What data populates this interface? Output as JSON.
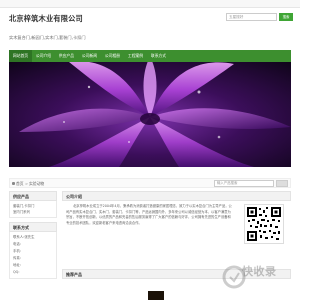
{
  "header": {
    "company_name": "北京梓筑木业有限公司",
    "tagline": "实木复合门,新园门,实木门,套装门,卡扣门",
    "search_placeholder": "五星搜好",
    "search_button": "搜索"
  },
  "nav": {
    "items": [
      {
        "label": "网站首页",
        "active": true
      },
      {
        "label": "公司介绍",
        "active": false
      },
      {
        "label": "供应产品",
        "active": false
      },
      {
        "label": "公司新闻",
        "active": false
      },
      {
        "label": "公司相册",
        "active": false
      },
      {
        "label": "工程案例",
        "active": false
      },
      {
        "label": "联系方式",
        "active": false
      }
    ]
  },
  "breadcrumb": {
    "home": "首页",
    "separator": ">",
    "current": "实验动物"
  },
  "keyword_search": {
    "placeholder": "输入产品搜索"
  },
  "sidebar": {
    "products_title": "供应产品",
    "products": [
      "套装门,卡扣门",
      "室内门系列"
    ],
    "contact_title": "联系方式",
    "contact_lines": [
      "联系人:张先生",
      "电话:",
      "手机:",
      "传真:",
      "地址:",
      "QQ:"
    ]
  },
  "main": {
    "intro_title": "公司介绍",
    "intro_text": "北京梓筑木业成立于2004年4月，秉承着为消费者打造健康的家居理念，致力于以实木复合门为主导产品，公司产品有实木复合门、实木门、套装门、卡扣门等，产品远销国内外，多年来公司以诚信经营为本，以客户满意为宗旨，不断开拓创新，以优质的产品和完善的售后服务赢得了广大客户的信赖与好评，公司拥有先进的生产设备和专业的技术团队，欢迎新老客户来电咨询洽谈合作。",
    "products_title": "推荐产品"
  },
  "watermark": {
    "text": "快收录"
  },
  "colors": {
    "nav_bg": "#3d8f2f",
    "nav_active": "#2e7424",
    "accent": "#3fa535"
  }
}
